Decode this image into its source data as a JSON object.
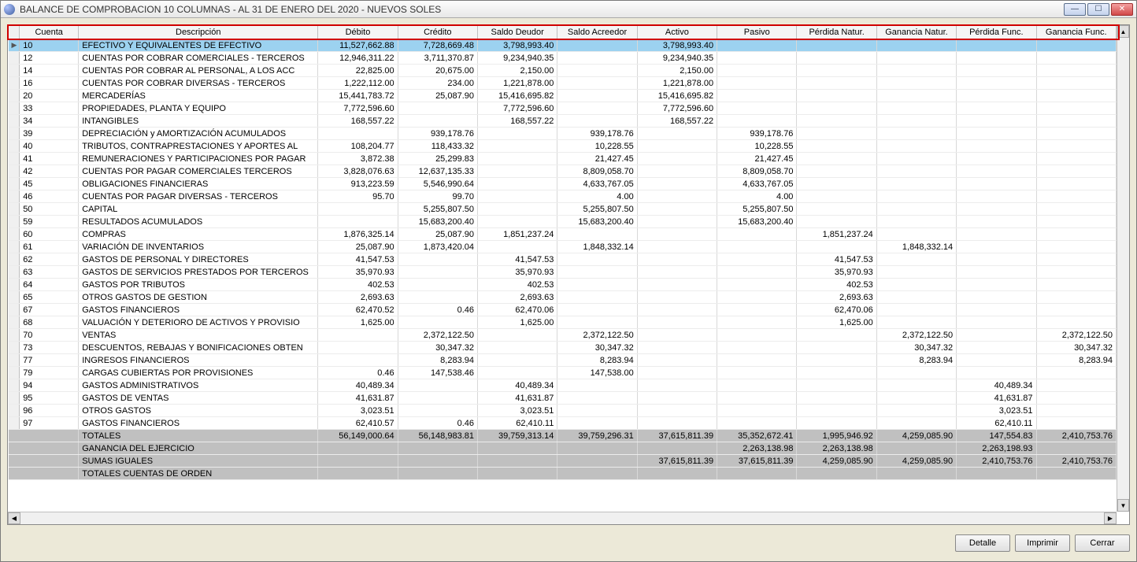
{
  "window": {
    "title": "BALANCE DE COMPROBACION 10 COLUMNAS - AL 31 DE ENERO DEL 2020 - NUEVOS SOLES"
  },
  "columns": {
    "cuenta": "Cuenta",
    "descripcion": "Descripción",
    "debito": "Débito",
    "credito": "Crédito",
    "saldo_deudor": "Saldo Deudor",
    "saldo_acreedor": "Saldo Acreedor",
    "activo": "Activo",
    "pasivo": "Pasivo",
    "perdida_natur": "Pérdida Natur.",
    "ganancia_natur": "Ganancia Natur.",
    "perdida_func": "Pérdida Func.",
    "ganancia_func": "Ganancia Func."
  },
  "rows": [
    {
      "cuenta": "10",
      "desc": "EFECTIVO Y EQUIVALENTES DE EFECTIVO",
      "debito": "11,527,662.88",
      "credito": "7,728,669.48",
      "sd": "3,798,993.40",
      "sa": "",
      "activo": "3,798,993.40",
      "pasivo": "",
      "pn": "",
      "gn": "",
      "pf": "",
      "gf": "",
      "sel": true
    },
    {
      "cuenta": "12",
      "desc": "CUENTAS POR COBRAR COMERCIALES - TERCEROS",
      "debito": "12,946,311.22",
      "credito": "3,711,370.87",
      "sd": "9,234,940.35",
      "sa": "",
      "activo": "9,234,940.35",
      "pasivo": "",
      "pn": "",
      "gn": "",
      "pf": "",
      "gf": ""
    },
    {
      "cuenta": "14",
      "desc": "CUENTAS POR COBRAR AL PERSONAL, A LOS ACC",
      "debito": "22,825.00",
      "credito": "20,675.00",
      "sd": "2,150.00",
      "sa": "",
      "activo": "2,150.00",
      "pasivo": "",
      "pn": "",
      "gn": "",
      "pf": "",
      "gf": ""
    },
    {
      "cuenta": "16",
      "desc": "CUENTAS POR COBRAR DIVERSAS - TERCEROS",
      "debito": "1,222,112.00",
      "credito": "234.00",
      "sd": "1,221,878.00",
      "sa": "",
      "activo": "1,221,878.00",
      "pasivo": "",
      "pn": "",
      "gn": "",
      "pf": "",
      "gf": ""
    },
    {
      "cuenta": "20",
      "desc": "MERCADERÍAS",
      "debito": "15,441,783.72",
      "credito": "25,087.90",
      "sd": "15,416,695.82",
      "sa": "",
      "activo": "15,416,695.82",
      "pasivo": "",
      "pn": "",
      "gn": "",
      "pf": "",
      "gf": ""
    },
    {
      "cuenta": "33",
      "desc": "PROPIEDADES, PLANTA Y EQUIPO",
      "debito": "7,772,596.60",
      "credito": "",
      "sd": "7,772,596.60",
      "sa": "",
      "activo": "7,772,596.60",
      "pasivo": "",
      "pn": "",
      "gn": "",
      "pf": "",
      "gf": ""
    },
    {
      "cuenta": "34",
      "desc": "INTANGIBLES",
      "debito": "168,557.22",
      "credito": "",
      "sd": "168,557.22",
      "sa": "",
      "activo": "168,557.22",
      "pasivo": "",
      "pn": "",
      "gn": "",
      "pf": "",
      "gf": ""
    },
    {
      "cuenta": "39",
      "desc": "DEPRECIACIÓN y AMORTIZACIÓN ACUMULADOS",
      "debito": "",
      "credito": "939,178.76",
      "sd": "",
      "sa": "939,178.76",
      "activo": "",
      "pasivo": "939,178.76",
      "pn": "",
      "gn": "",
      "pf": "",
      "gf": ""
    },
    {
      "cuenta": "40",
      "desc": "TRIBUTOS, CONTRAPRESTACIONES Y APORTES AL",
      "debito": "108,204.77",
      "credito": "118,433.32",
      "sd": "",
      "sa": "10,228.55",
      "activo": "",
      "pasivo": "10,228.55",
      "pn": "",
      "gn": "",
      "pf": "",
      "gf": ""
    },
    {
      "cuenta": "41",
      "desc": "REMUNERACIONES Y PARTICIPACIONES POR PAGAR",
      "debito": "3,872.38",
      "credito": "25,299.83",
      "sd": "",
      "sa": "21,427.45",
      "activo": "",
      "pasivo": "21,427.45",
      "pn": "",
      "gn": "",
      "pf": "",
      "gf": ""
    },
    {
      "cuenta": "42",
      "desc": "CUENTAS POR PAGAR COMERCIALES TERCEROS",
      "debito": "3,828,076.63",
      "credito": "12,637,135.33",
      "sd": "",
      "sa": "8,809,058.70",
      "activo": "",
      "pasivo": "8,809,058.70",
      "pn": "",
      "gn": "",
      "pf": "",
      "gf": ""
    },
    {
      "cuenta": "45",
      "desc": "OBLIGACIONES FINANCIERAS",
      "debito": "913,223.59",
      "credito": "5,546,990.64",
      "sd": "",
      "sa": "4,633,767.05",
      "activo": "",
      "pasivo": "4,633,767.05",
      "pn": "",
      "gn": "",
      "pf": "",
      "gf": ""
    },
    {
      "cuenta": "46",
      "desc": "CUENTAS POR PAGAR DIVERSAS - TERCEROS",
      "debito": "95.70",
      "credito": "99.70",
      "sd": "",
      "sa": "4.00",
      "activo": "",
      "pasivo": "4.00",
      "pn": "",
      "gn": "",
      "pf": "",
      "gf": ""
    },
    {
      "cuenta": "50",
      "desc": "CAPITAL",
      "debito": "",
      "credito": "5,255,807.50",
      "sd": "",
      "sa": "5,255,807.50",
      "activo": "",
      "pasivo": "5,255,807.50",
      "pn": "",
      "gn": "",
      "pf": "",
      "gf": ""
    },
    {
      "cuenta": "59",
      "desc": "RESULTADOS ACUMULADOS",
      "debito": "",
      "credito": "15,683,200.40",
      "sd": "",
      "sa": "15,683,200.40",
      "activo": "",
      "pasivo": "15,683,200.40",
      "pn": "",
      "gn": "",
      "pf": "",
      "gf": ""
    },
    {
      "cuenta": "60",
      "desc": "COMPRAS",
      "debito": "1,876,325.14",
      "credito": "25,087.90",
      "sd": "1,851,237.24",
      "sa": "",
      "activo": "",
      "pasivo": "",
      "pn": "1,851,237.24",
      "gn": "",
      "pf": "",
      "gf": ""
    },
    {
      "cuenta": "61",
      "desc": "VARIACIÓN DE INVENTARIOS",
      "debito": "25,087.90",
      "credito": "1,873,420.04",
      "sd": "",
      "sa": "1,848,332.14",
      "activo": "",
      "pasivo": "",
      "pn": "",
      "gn": "1,848,332.14",
      "pf": "",
      "gf": ""
    },
    {
      "cuenta": "62",
      "desc": "GASTOS DE PERSONAL Y DIRECTORES",
      "debito": "41,547.53",
      "credito": "",
      "sd": "41,547.53",
      "sa": "",
      "activo": "",
      "pasivo": "",
      "pn": "41,547.53",
      "gn": "",
      "pf": "",
      "gf": ""
    },
    {
      "cuenta": "63",
      "desc": "GASTOS DE SERVICIOS PRESTADOS POR TERCEROS",
      "debito": "35,970.93",
      "credito": "",
      "sd": "35,970.93",
      "sa": "",
      "activo": "",
      "pasivo": "",
      "pn": "35,970.93",
      "gn": "",
      "pf": "",
      "gf": ""
    },
    {
      "cuenta": "64",
      "desc": "GASTOS POR TRIBUTOS",
      "debito": "402.53",
      "credito": "",
      "sd": "402.53",
      "sa": "",
      "activo": "",
      "pasivo": "",
      "pn": "402.53",
      "gn": "",
      "pf": "",
      "gf": ""
    },
    {
      "cuenta": "65",
      "desc": "OTROS GASTOS DE GESTION",
      "debito": "2,693.63",
      "credito": "",
      "sd": "2,693.63",
      "sa": "",
      "activo": "",
      "pasivo": "",
      "pn": "2,693.63",
      "gn": "",
      "pf": "",
      "gf": ""
    },
    {
      "cuenta": "67",
      "desc": "GASTOS FINANCIEROS",
      "debito": "62,470.52",
      "credito": "0.46",
      "sd": "62,470.06",
      "sa": "",
      "activo": "",
      "pasivo": "",
      "pn": "62,470.06",
      "gn": "",
      "pf": "",
      "gf": ""
    },
    {
      "cuenta": "68",
      "desc": "VALUACIÓN Y DETERIORO DE ACTIVOS Y PROVISIO",
      "debito": "1,625.00",
      "credito": "",
      "sd": "1,625.00",
      "sa": "",
      "activo": "",
      "pasivo": "",
      "pn": "1,625.00",
      "gn": "",
      "pf": "",
      "gf": ""
    },
    {
      "cuenta": "70",
      "desc": "VENTAS",
      "debito": "",
      "credito": "2,372,122.50",
      "sd": "",
      "sa": "2,372,122.50",
      "activo": "",
      "pasivo": "",
      "pn": "",
      "gn": "2,372,122.50",
      "pf": "",
      "gf": "2,372,122.50"
    },
    {
      "cuenta": "73",
      "desc": "DESCUENTOS, REBAJAS Y BONIFICACIONES OBTEN",
      "debito": "",
      "credito": "30,347.32",
      "sd": "",
      "sa": "30,347.32",
      "activo": "",
      "pasivo": "",
      "pn": "",
      "gn": "30,347.32",
      "pf": "",
      "gf": "30,347.32"
    },
    {
      "cuenta": "77",
      "desc": "INGRESOS FINANCIEROS",
      "debito": "",
      "credito": "8,283.94",
      "sd": "",
      "sa": "8,283.94",
      "activo": "",
      "pasivo": "",
      "pn": "",
      "gn": "8,283.94",
      "pf": "",
      "gf": "8,283.94"
    },
    {
      "cuenta": "79",
      "desc": "CARGAS CUBIERTAS POR PROVISIONES",
      "debito": "0.46",
      "credito": "147,538.46",
      "sd": "",
      "sa": "147,538.00",
      "activo": "",
      "pasivo": "",
      "pn": "",
      "gn": "",
      "pf": "",
      "gf": ""
    },
    {
      "cuenta": "94",
      "desc": "GASTOS ADMINISTRATIVOS",
      "debito": "40,489.34",
      "credito": "",
      "sd": "40,489.34",
      "sa": "",
      "activo": "",
      "pasivo": "",
      "pn": "",
      "gn": "",
      "pf": "40,489.34",
      "gf": ""
    },
    {
      "cuenta": "95",
      "desc": "GASTOS DE VENTAS",
      "debito": "41,631.87",
      "credito": "",
      "sd": "41,631.87",
      "sa": "",
      "activo": "",
      "pasivo": "",
      "pn": "",
      "gn": "",
      "pf": "41,631.87",
      "gf": ""
    },
    {
      "cuenta": "96",
      "desc": "OTROS GASTOS",
      "debito": "3,023.51",
      "credito": "",
      "sd": "3,023.51",
      "sa": "",
      "activo": "",
      "pasivo": "",
      "pn": "",
      "gn": "",
      "pf": "3,023.51",
      "gf": ""
    },
    {
      "cuenta": "97",
      "desc": "GASTOS FINANCIEROS",
      "debito": "62,410.57",
      "credito": "0.46",
      "sd": "62,410.11",
      "sa": "",
      "activo": "",
      "pasivo": "",
      "pn": "",
      "gn": "",
      "pf": "62,410.11",
      "gf": ""
    }
  ],
  "totals": [
    {
      "desc": "TOTALES",
      "debito": "56,149,000.64",
      "credito": "56,148,983.81",
      "sd": "39,759,313.14",
      "sa": "39,759,296.31",
      "activo": "37,615,811.39",
      "pasivo": "35,352,672.41",
      "pn": "1,995,946.92",
      "gn": "4,259,085.90",
      "pf": "147,554.83",
      "gf": "2,410,753.76"
    },
    {
      "desc": "GANANCIA DEL EJERCICIO",
      "debito": "",
      "credito": "",
      "sd": "",
      "sa": "",
      "activo": "",
      "pasivo": "2,263,138.98",
      "pn": "2,263,138.98",
      "gn": "",
      "pf": "2,263,198.93",
      "gf": ""
    },
    {
      "desc": "SUMAS IGUALES",
      "debito": "",
      "credito": "",
      "sd": "",
      "sa": "",
      "activo": "37,615,811.39",
      "pasivo": "37,615,811.39",
      "pn": "4,259,085.90",
      "gn": "4,259,085.90",
      "pf": "2,410,753.76",
      "gf": "2,410,753.76"
    },
    {
      "desc": "TOTALES CUENTAS DE ORDEN",
      "debito": "",
      "credito": "",
      "sd": "",
      "sa": "",
      "activo": "",
      "pasivo": "",
      "pn": "",
      "gn": "",
      "pf": "",
      "gf": ""
    }
  ],
  "buttons": {
    "detalle": "Detalle",
    "imprimir": "Imprimir",
    "cerrar": "Cerrar"
  }
}
